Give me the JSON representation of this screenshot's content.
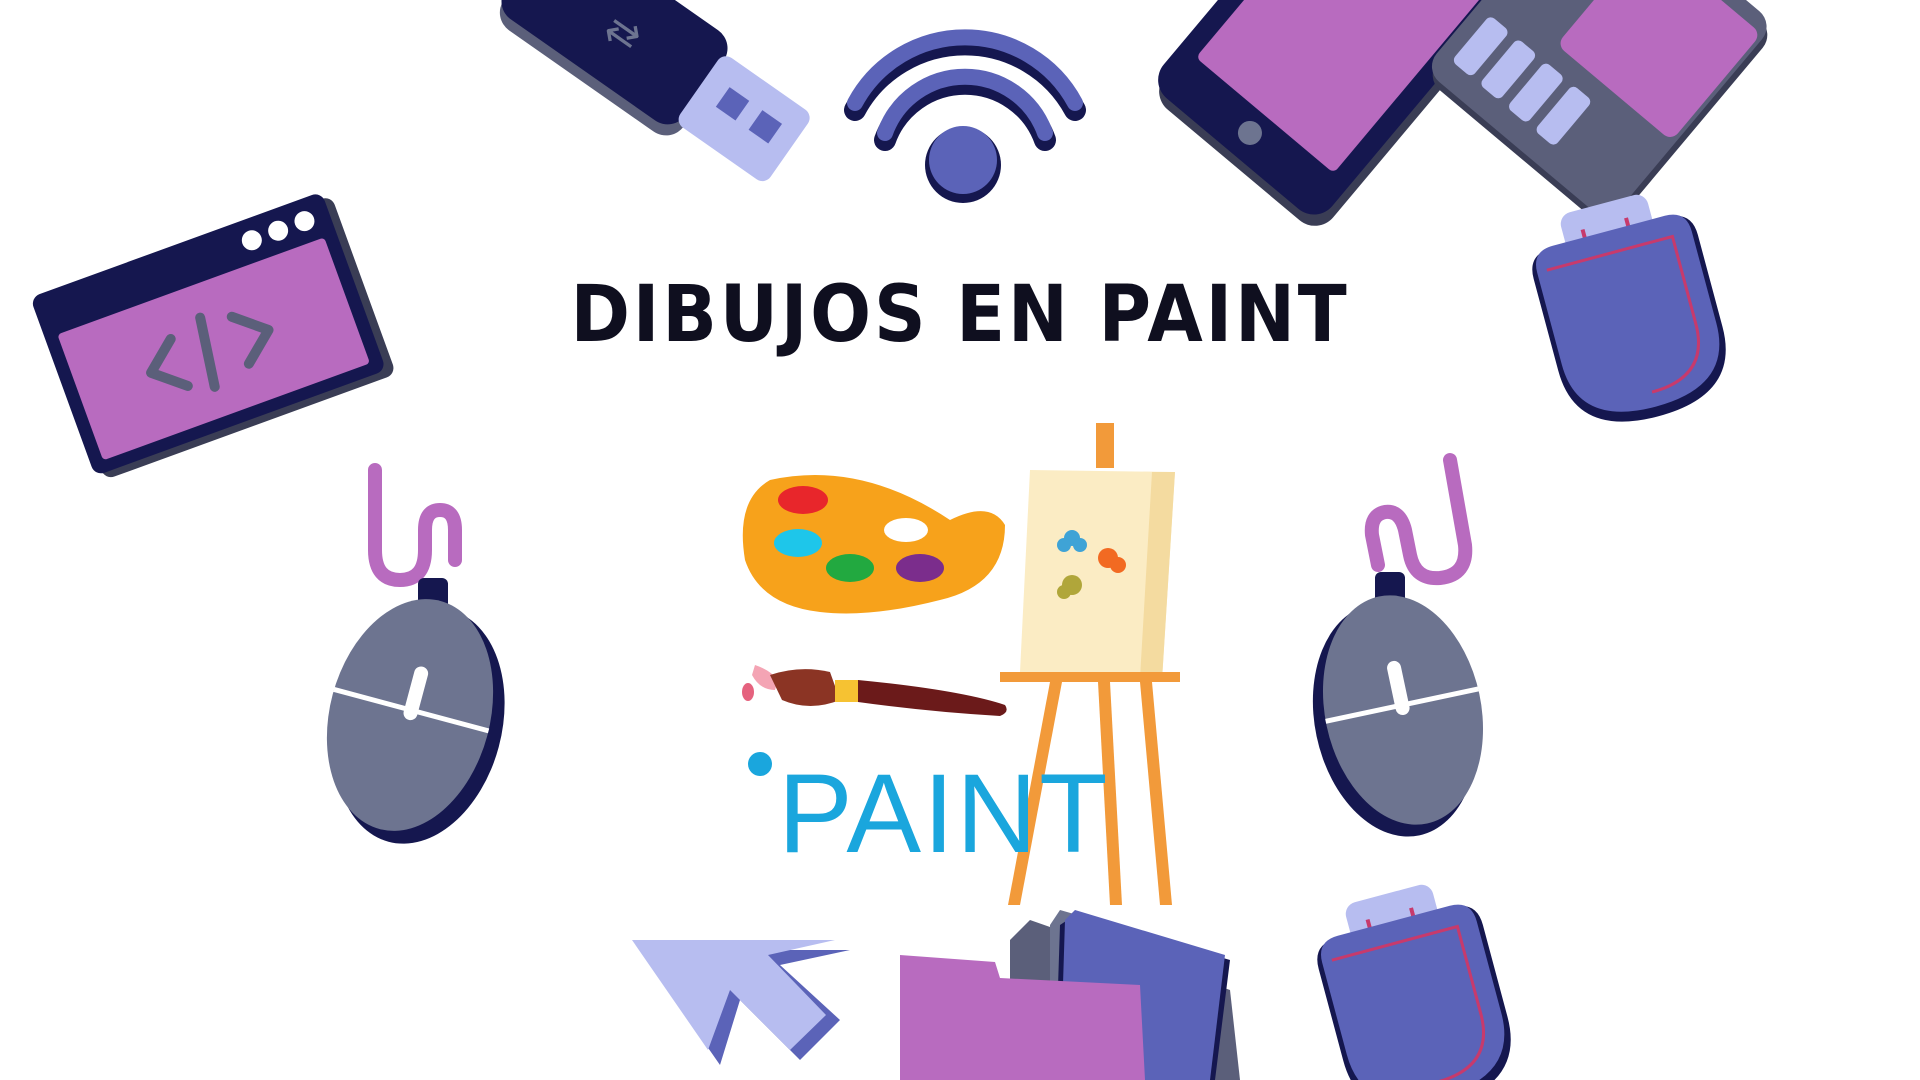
{
  "title": "DIBUJOS EN PAINT",
  "logo_text": "PAINT",
  "colors": {
    "navy": "#15174f",
    "purple": "#b86bbf",
    "indigo": "#5b63b8",
    "lavender": "#b7bdf0",
    "slate": "#6d7490",
    "logo_blue": "#1aa6dd",
    "easel_orange": "#f29a3a",
    "canvas_cream": "#fbecc4",
    "palette_orange": "#f7a21b"
  },
  "icons": [
    "usb-drive-icon",
    "wifi-icon",
    "smartphone-icon",
    "sd-card-icon",
    "code-window-icon",
    "usb-plug-icon",
    "mouse-icon",
    "cursor-arrow-icon",
    "folder-icon",
    "paint-palette-icon",
    "paintbrush-icon",
    "easel-icon"
  ]
}
